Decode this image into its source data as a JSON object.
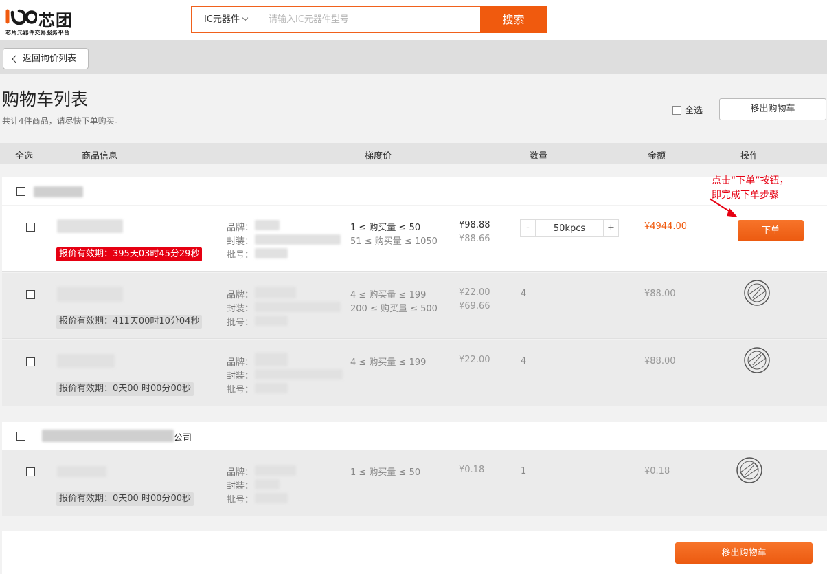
{
  "header": {
    "logo_mark": "ιΘ",
    "logo_text": "芯团",
    "logo_sub": "芯片元器件交易服务平台",
    "search_category": "IC元器件",
    "search_placeholder": "请输入IC元器件型号",
    "search_button": "搜索"
  },
  "nav": {
    "back_label": "返回询价列表"
  },
  "page": {
    "title": "购物车列表",
    "subtitle": "共计4件商品，请尽快下单购买。",
    "select_all_label": "全选",
    "remove_label": "移出购物车"
  },
  "table_headers": [
    "全选",
    "商品信息",
    "梯度价",
    "数量",
    "金额",
    "操作"
  ],
  "groups": [
    {
      "supplier_visible_suffix": "",
      "rows": [
        {
          "validity": "报价有效期：395天03时45分29秒",
          "brand_label": "品牌：",
          "package_label": "封装：",
          "batch_label": "批号：",
          "tiers": [
            "1 ≤ 购买量 ≤ 50",
            "51 ≤ 购买量 ≤ 1050"
          ],
          "prices": [
            "¥98.88",
            "¥88.66"
          ],
          "quantity": "50kpcs",
          "amount": "¥4944.00",
          "action": "下单"
        },
        {
          "validity": "报价有效期：411天00时10分04秒",
          "brand_label": "品牌：",
          "package_label": "封装：",
          "batch_label": "批号：",
          "tiers": [
            "4 ≤ 购买量 ≤ 199",
            "200 ≤ 购买量 ≤ 500"
          ],
          "prices": [
            "¥22.00",
            "¥69.66"
          ],
          "quantity": "4",
          "amount": "¥88.00",
          "action_icon": "expired-stamp-icon"
        },
        {
          "validity": "报价有效期：0天00 时00分00秒",
          "brand_label": "品牌：",
          "package_label": "封装：",
          "batch_label": "批号：",
          "tiers": [
            "4 ≤ 购买量 ≤ 199"
          ],
          "prices": [
            "¥22.00"
          ],
          "quantity": "4",
          "amount": "¥88.00",
          "action_icon": "expired-stamp-icon"
        }
      ]
    },
    {
      "supplier_visible_suffix": "公司",
      "rows": [
        {
          "validity": "报价有效期：0天00 时00分00秒",
          "brand_label": "品牌：",
          "package_label": "封装：",
          "batch_label": "批号：",
          "tiers": [
            "1 ≤ 购买量 ≤ 50"
          ],
          "prices": [
            "¥0.18"
          ],
          "quantity": "1",
          "amount": "¥0.18",
          "action_icon": "expired-stamp-icon"
        }
      ]
    }
  ],
  "stepper": {
    "minus": "-",
    "plus": "+"
  },
  "annotation": {
    "line1": "点击“下单”按钮，",
    "line2": "即完成下单步骤"
  },
  "footer": {
    "remove_label": "移出购物车"
  },
  "colors": {
    "accent": "#f05a0e",
    "validity_hot": "#e60012"
  }
}
